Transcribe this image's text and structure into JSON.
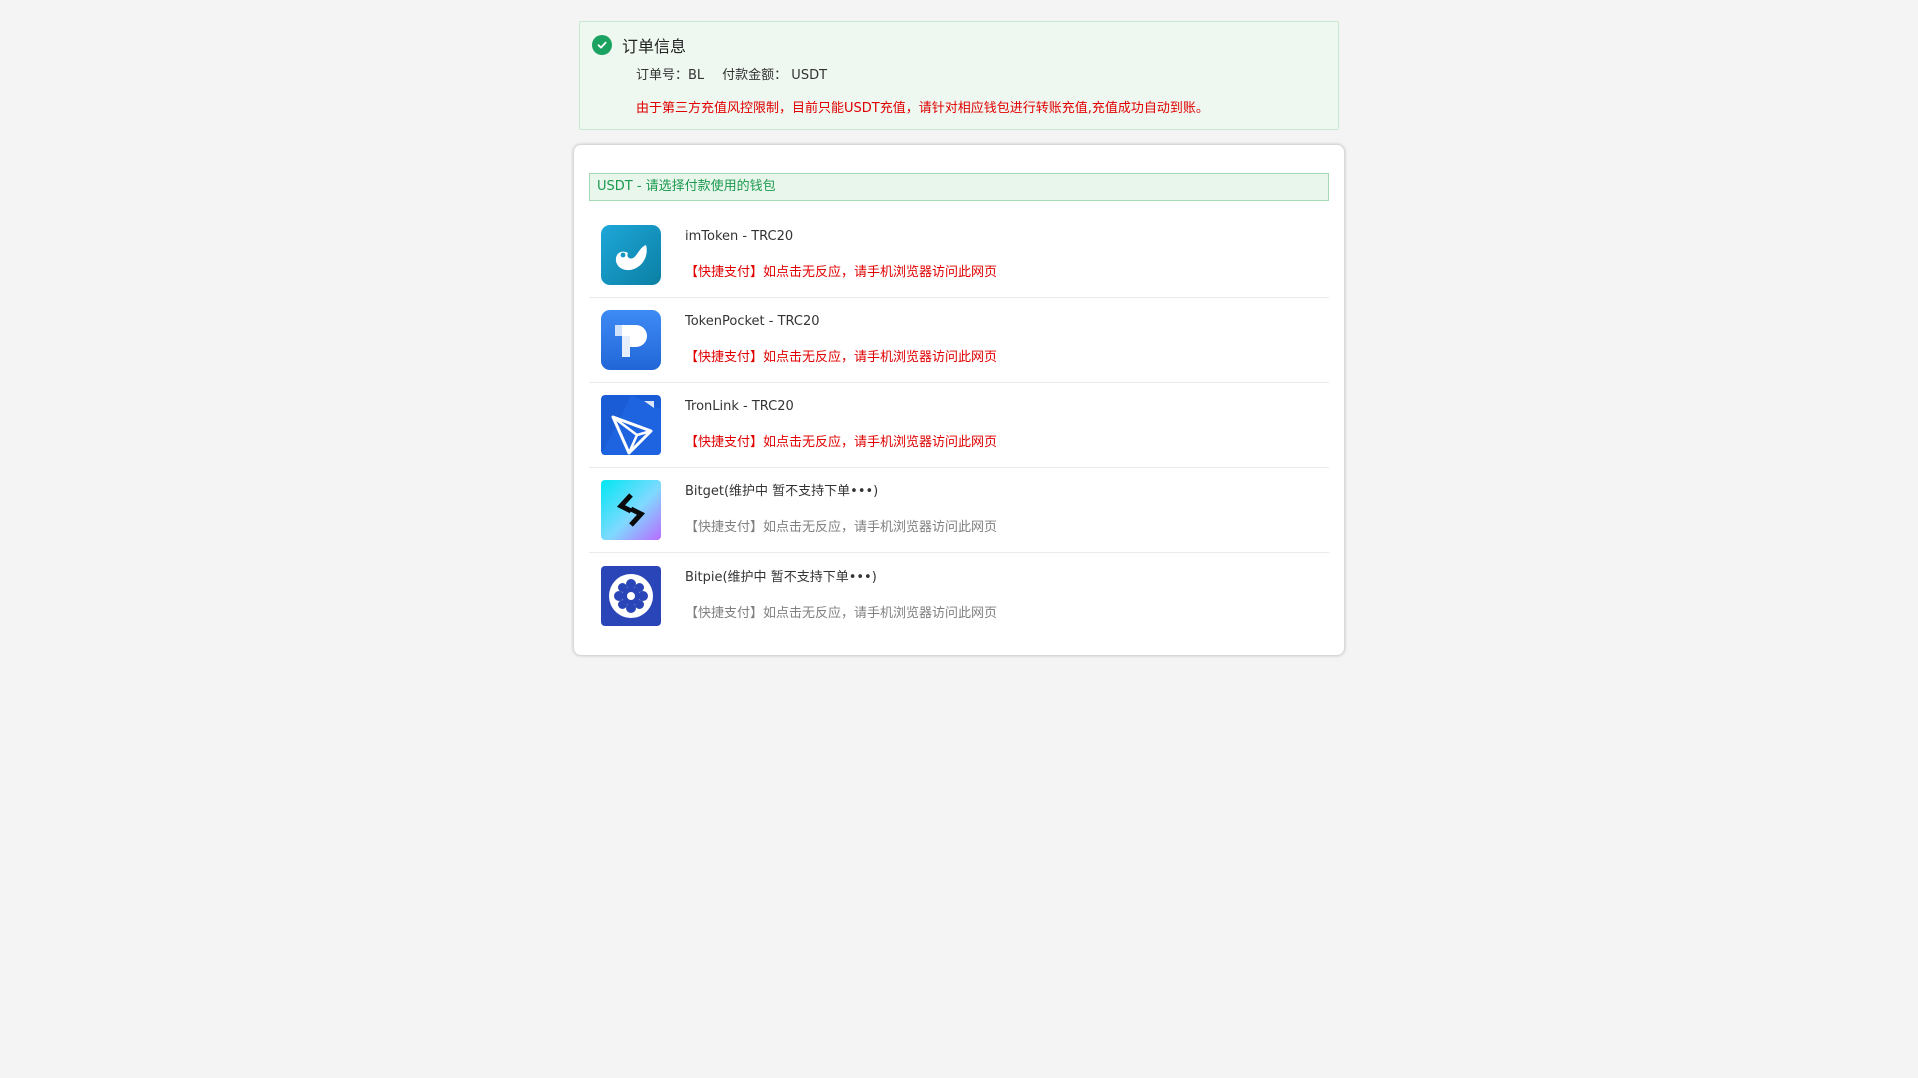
{
  "order": {
    "title": "订单信息",
    "order_no": "订单号：BL",
    "amount": "付款金额： USDT",
    "warning": "由于第三方充值风控限制，目前只能USDT充值，请针对相应钱包进行转账充值,充值成功自动到账。"
  },
  "wallet_section": {
    "header": "USDT - 请选择付款使用的钱包",
    "items": [
      {
        "name": "imToken - TRC20",
        "note": "【快捷支付】如点击无反应，请手机浏览器访问此网页",
        "icon": "imtoken-icon",
        "available": true
      },
      {
        "name": "TokenPocket - TRC20",
        "note": "【快捷支付】如点击无反应，请手机浏览器访问此网页",
        "icon": "tokenpocket-icon",
        "available": true
      },
      {
        "name": "TronLink - TRC20",
        "note": "【快捷支付】如点击无反应，请手机浏览器访问此网页",
        "icon": "tronlink-icon",
        "available": true
      },
      {
        "name": "Bitget(维护中 暂不支持下单•••)",
        "note": "【快捷支付】如点击无反应，请手机浏览器访问此网页",
        "icon": "bitget-icon",
        "available": false
      },
      {
        "name": "Bitpie(维护中 暂不支持下单•••)",
        "note": "【快捷支付】如点击无反应，请手机浏览器访问此网页",
        "icon": "bitpie-icon",
        "available": false
      }
    ]
  },
  "colors": {
    "success_green": "#1aa260",
    "warning_red": "#e00000",
    "disabled_gray": "#808080",
    "header_green": "#1a9a4e"
  }
}
